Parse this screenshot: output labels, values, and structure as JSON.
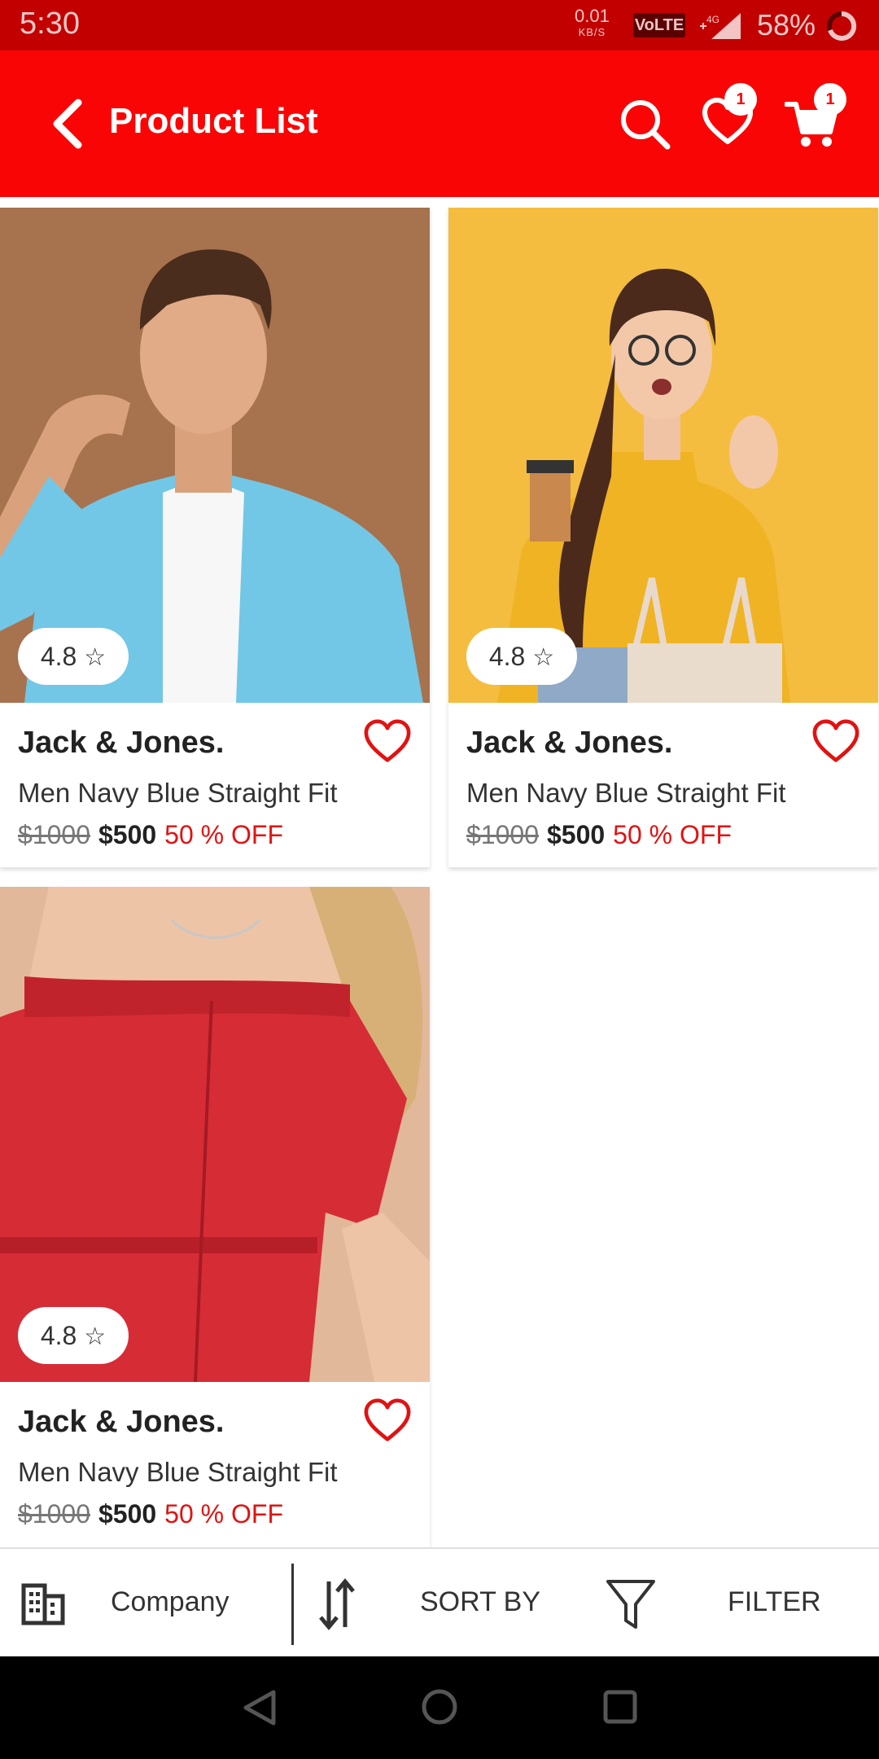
{
  "status_bar": {
    "time": "5:30",
    "net_speed": "0.01",
    "net_unit": "KB/S",
    "volte": "VoLTE",
    "network": "4G",
    "battery": "58%"
  },
  "app_bar": {
    "title": "Product List",
    "wishlist_count": "1",
    "cart_count": "1"
  },
  "products": [
    {
      "rating": "4.8",
      "brand": "Jack & Jones.",
      "name": "Men Navy Blue Straight Fit",
      "old_price": "$1000",
      "price": "$500",
      "discount": "50 % OFF"
    },
    {
      "rating": "4.8",
      "brand": "Jack & Jones.",
      "name": "Men Navy Blue Straight Fit",
      "old_price": "$1000",
      "price": "$500",
      "discount": "50 % OFF"
    },
    {
      "rating": "4.8",
      "brand": "Jack & Jones.",
      "name": "Men Navy Blue Straight Fit",
      "old_price": "$1000",
      "price": "$500",
      "discount": "50 % OFF"
    }
  ],
  "bottom_bar": {
    "company_label": "Company",
    "sort_label": "SORT BY",
    "filter_label": "FILTER"
  },
  "colors": {
    "accent": "#fa0505",
    "status_bar": "#c30000",
    "discount": "#e21212"
  }
}
